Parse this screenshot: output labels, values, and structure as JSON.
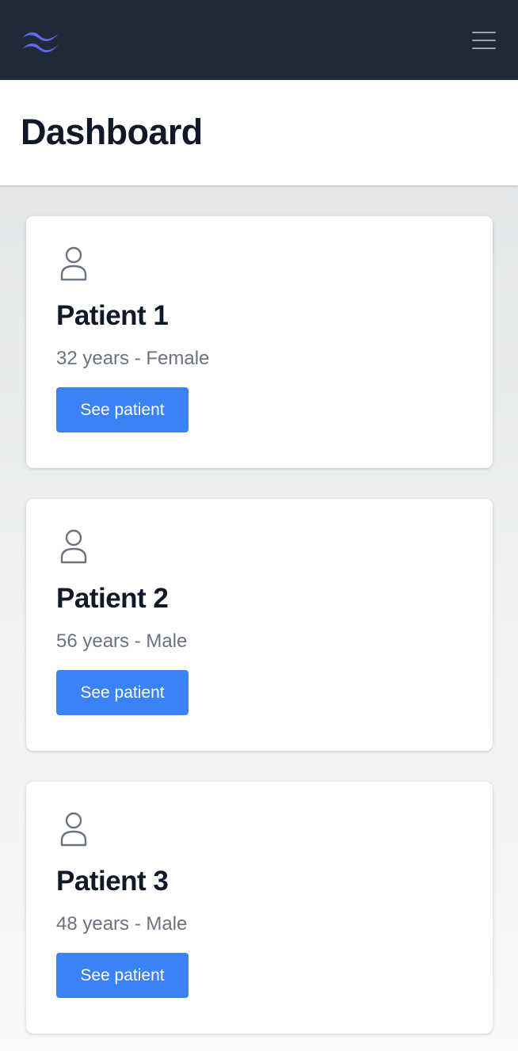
{
  "navbar": {
    "logo_icon": "wave-logo-icon",
    "logo_color": "#6366f1",
    "menu_icon": "hamburger-menu-icon",
    "background": "#1f2937"
  },
  "header": {
    "title": "Dashboard"
  },
  "patients": [
    {
      "name": "Patient 1",
      "details": "32 years - Female",
      "button_label": "See patient",
      "icon": "user-icon"
    },
    {
      "name": "Patient 2",
      "details": "56 years - Male",
      "button_label": "See patient",
      "icon": "user-icon"
    },
    {
      "name": "Patient 3",
      "details": "48 years - Male",
      "button_label": "See patient",
      "icon": "user-icon"
    }
  ],
  "colors": {
    "accent": "#3b82f6",
    "heading": "#111827",
    "muted": "#6b7280"
  }
}
